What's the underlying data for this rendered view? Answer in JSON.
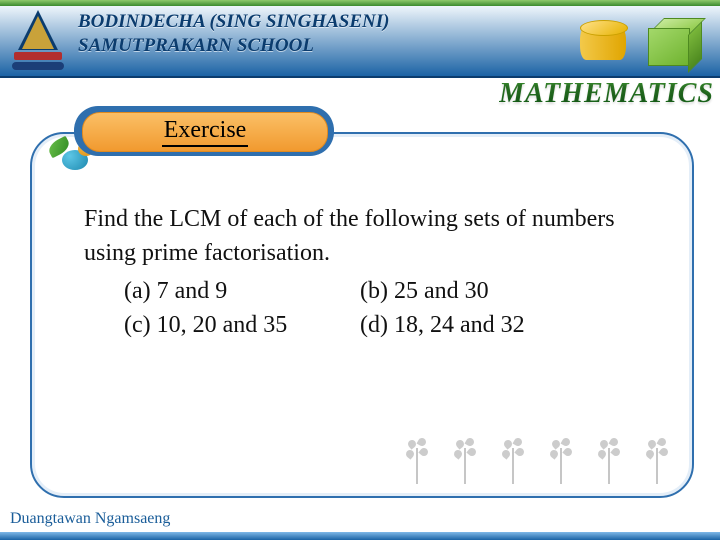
{
  "header": {
    "school_line1": "BODINDECHA (SING SINGHASENI)",
    "school_line2": "SAMUTPRAKARN SCHOOL",
    "subject": "MATHEMATICS"
  },
  "card": {
    "badge_label": "Exercise",
    "question": "Find the LCM of each of the following sets of numbers using prime factorisation.",
    "options": {
      "a": "(a) 7 and 9",
      "b": "(b) 25 and 30",
      "c": "(c) 10, 20 and 35",
      "d": "(d) 18, 24 and 32"
    }
  },
  "footer": {
    "author": "Duangtawan Ngamsaeng"
  }
}
